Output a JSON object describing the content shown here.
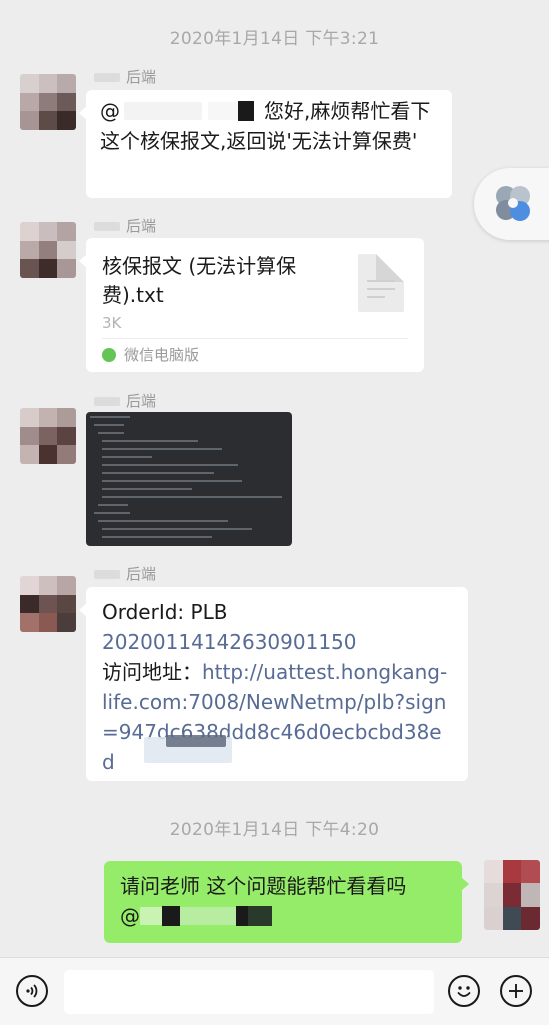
{
  "timestamps": [
    "2020年1月14日 下午3:21",
    "2020年1月14日 下午4:20"
  ],
  "messages": {
    "m1": {
      "sender": "后端",
      "mention": "@",
      "text": "您好,麻烦帮忙看下这个核保报文,返回说'无法计算保费'"
    },
    "m2": {
      "sender": "后端",
      "file_name": "核保报文 (无法计算保费).txt",
      "file_size": "3K",
      "file_source": "微信电脑版"
    },
    "m3": {
      "sender": "后端"
    },
    "m4": {
      "sender": "后端",
      "order_label": "OrderId: PLB",
      "order_id": "20200114142630901150",
      "address_label": "访问地址：",
      "url": "http://uattest.hongkang-life.com:7008/NewNetmp/plb?sign=947dc638ddd8c46d0ecbcbd38ed"
    },
    "m5": {
      "text": "请问老师 这个问题能帮忙看看吗",
      "mention": "@"
    }
  },
  "icons": {
    "voice": "voice-input-icon",
    "emoji": "emoji-icon",
    "plus": "more-plus-icon",
    "file": "txt-file-icon",
    "floating": "floating-window-icon"
  },
  "colors": {
    "background": "#ededed",
    "self_bubble": "#95ec69",
    "link": "#576b95"
  }
}
